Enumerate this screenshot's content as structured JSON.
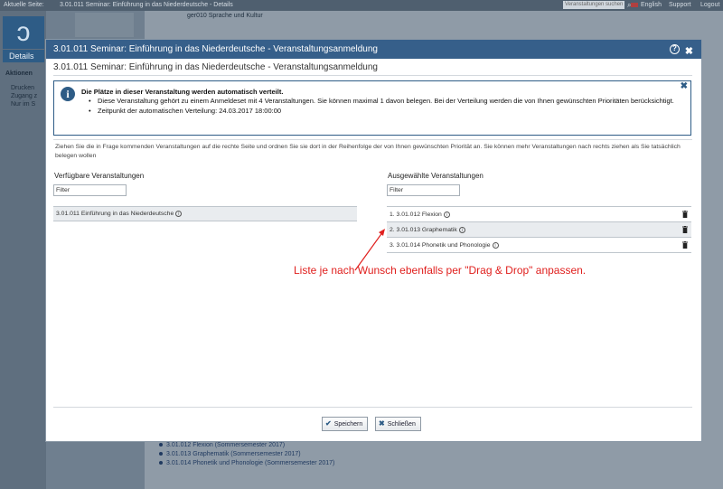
{
  "background": {
    "crumb_label": "Aktuelle Seite:",
    "crumb_text": "3.01.011 Seminar: Einführung in das Niederdeutsche - Details",
    "search_placeholder": "Veranstaltungen suchen",
    "lang_label": "English",
    "support_label": "Support",
    "logout_label": "Logout",
    "details_label": "Details",
    "aktionen_label": "Aktionen",
    "actions": [
      "Drucken",
      "Zugang z",
      "Nur im S"
    ],
    "sprache_label": "ger010 Sprache und Kultur",
    "course_list": [
      "3.01.012 Flexion (Sommersemester 2017)",
      "3.01.013 Graphematik (Sommersemester 2017)",
      "3.01.014 Phonetik und Phonologie (Sommersemester 2017)"
    ]
  },
  "modal": {
    "title": "3.01.011 Seminar: Einführung in das Niederdeutsche - Veranstaltungsanmeldung",
    "heading": "3.01.011 Seminar: Einführung in das Niederdeutsche - Veranstaltungsanmeldung",
    "info": {
      "title": "Die Plätze in dieser Veranstaltung werden automatisch verteilt.",
      "bullets": [
        "Diese Veranstaltung gehört zu einem Anmeldeset mit 4 Veranstaltungen. Sie können maximal 1 davon belegen. Bei der Verteilung werden die von Ihnen gewünschten Prioritäten berücksichtigt.",
        "Zeitpunkt der automatischen Verteilung: 24.03.2017 18:00:00"
      ]
    },
    "instruction": "Ziehen Sie die in Frage kommenden Veranstaltungen auf die rechte Seite und ordnen Sie sie dort in der Reihenfolge der von Ihnen gewünschten Priorität an. Sie können mehr Veranstaltungen nach rechts ziehen als Sie tatsächlich belegen wollen",
    "available": {
      "title": "Verfügbare Veranstaltungen",
      "filter_placeholder": "Filter",
      "items": [
        "3.01.011 Einführung in das Niederdeutsche"
      ]
    },
    "selected": {
      "title": "Ausgewählte Veranstaltungen",
      "filter_placeholder": "Filter",
      "items": [
        "1. 3.01.012 Flexion",
        "2. 3.01.013 Graphematik",
        "3. 3.01.014 Phonetik und Phonologie"
      ]
    },
    "annotation": "Liste je nach Wunsch ebenfalls per \"Drag & Drop\" anpassen.",
    "buttons": {
      "save_label": "Speichern",
      "close_label": "Schließen"
    }
  },
  "colors": {
    "titlebar": "#365f8a",
    "annotation": "#e0201e"
  }
}
